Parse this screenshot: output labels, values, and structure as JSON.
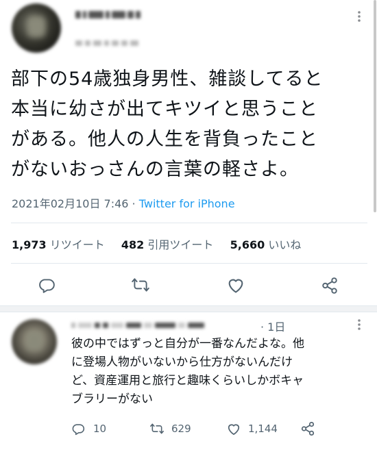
{
  "tweet": {
    "text_lines": [
      "部下の54歳独身男性、雑談してると",
      "本当に幼さが出てキツイと思うこと",
      "がある。他人の人生を背負ったこと",
      "がないおっさんの言葉の軽さよ。"
    ],
    "timestamp": "2021年02月10日 7:46",
    "separator": " · ",
    "source": "Twitter for iPhone",
    "stats": {
      "retweets": "1,973",
      "retweets_label": "リツイート",
      "quotes": "482",
      "quotes_label": "引用ツイート",
      "likes": "5,660",
      "likes_label": "いいね"
    },
    "icons": [
      "reply-icon",
      "retweet-icon",
      "like-icon",
      "share-icon"
    ]
  },
  "reply": {
    "time": "1日",
    "text_lines": [
      "彼の中ではずっと自分が一番なんだよな。他",
      "に登場人物がいないから仕方がないんだけ",
      "ど、資産運用と旅行と趣味くらいしかボキャ",
      "ブラリーがない"
    ],
    "counts": {
      "replies": "10",
      "retweets": "629",
      "likes": "1,144"
    }
  },
  "colors": {
    "accent": "#1d9bf0",
    "secondary_text": "#536471",
    "divider": "#e1e8ed"
  }
}
